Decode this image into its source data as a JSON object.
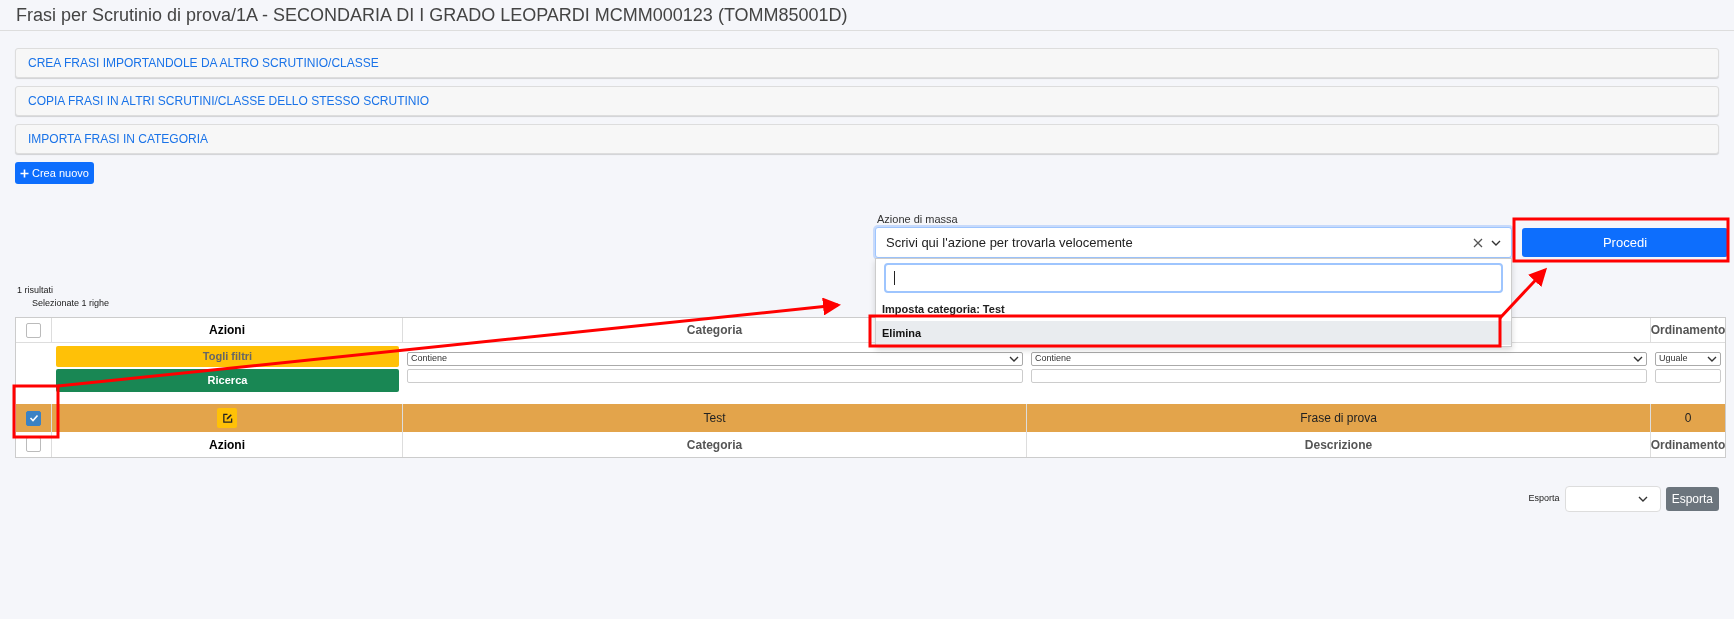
{
  "window": {
    "title": "Frasi per Scrutinio di prova/1A - SECONDARIA DI I GRADO LEOPARDI MCMM000123 (TOMM85001D)"
  },
  "panels": [
    {
      "label": "CREA FRASI IMPORTANDOLE DA ALTRO SCRUTINIO/CLASSE"
    },
    {
      "label": "COPIA FRASI IN ALTRI SCRUTINI/CLASSE DELLO STESSO SCRUTINIO"
    },
    {
      "label": "IMPORTA FRASI IN CATEGORIA"
    }
  ],
  "create_button": {
    "label": "Crea nuovo"
  },
  "mass_action": {
    "label": "Azione di massa",
    "placeholder": "Scrivi qui l'azione per trovarla velocemente",
    "expanded": true,
    "options": [
      {
        "label": "Imposta categoria: Test",
        "selected": false
      },
      {
        "label": "Elimina",
        "selected": true
      }
    ],
    "button": "Procedi"
  },
  "results": {
    "count": "1 risultati",
    "selected_rows": "Selezionate 1 righe"
  },
  "table": {
    "header": {
      "checked": false,
      "cells": [
        {
          "kind": "actions",
          "label": "Azioni"
        },
        {
          "kind": "category",
          "label": "Categoria"
        },
        {
          "kind": "order",
          "label": "Ordinamento"
        }
      ]
    },
    "filters": {
      "clear": "Togli filtri",
      "search": "Ricerca",
      "columns": [
        {
          "kind": "category",
          "operator": "Contiene"
        },
        {
          "kind": "description",
          "operator": "Contiene"
        },
        {
          "kind": "order",
          "operator": "Uguale"
        }
      ]
    },
    "rows": [
      {
        "checked": true,
        "selected": true,
        "category": "Test",
        "description": "Frase di prova",
        "order": "0"
      }
    ],
    "footer": {
      "checked": false,
      "cells": [
        {
          "kind": "actions",
          "label": "Azioni"
        },
        {
          "kind": "category",
          "label": "Categoria"
        },
        {
          "kind": "description",
          "label": "Descrizione"
        },
        {
          "kind": "order",
          "label": "Ordinamento"
        }
      ]
    }
  },
  "export": {
    "label": "Esporta",
    "button": "Esporta"
  }
}
